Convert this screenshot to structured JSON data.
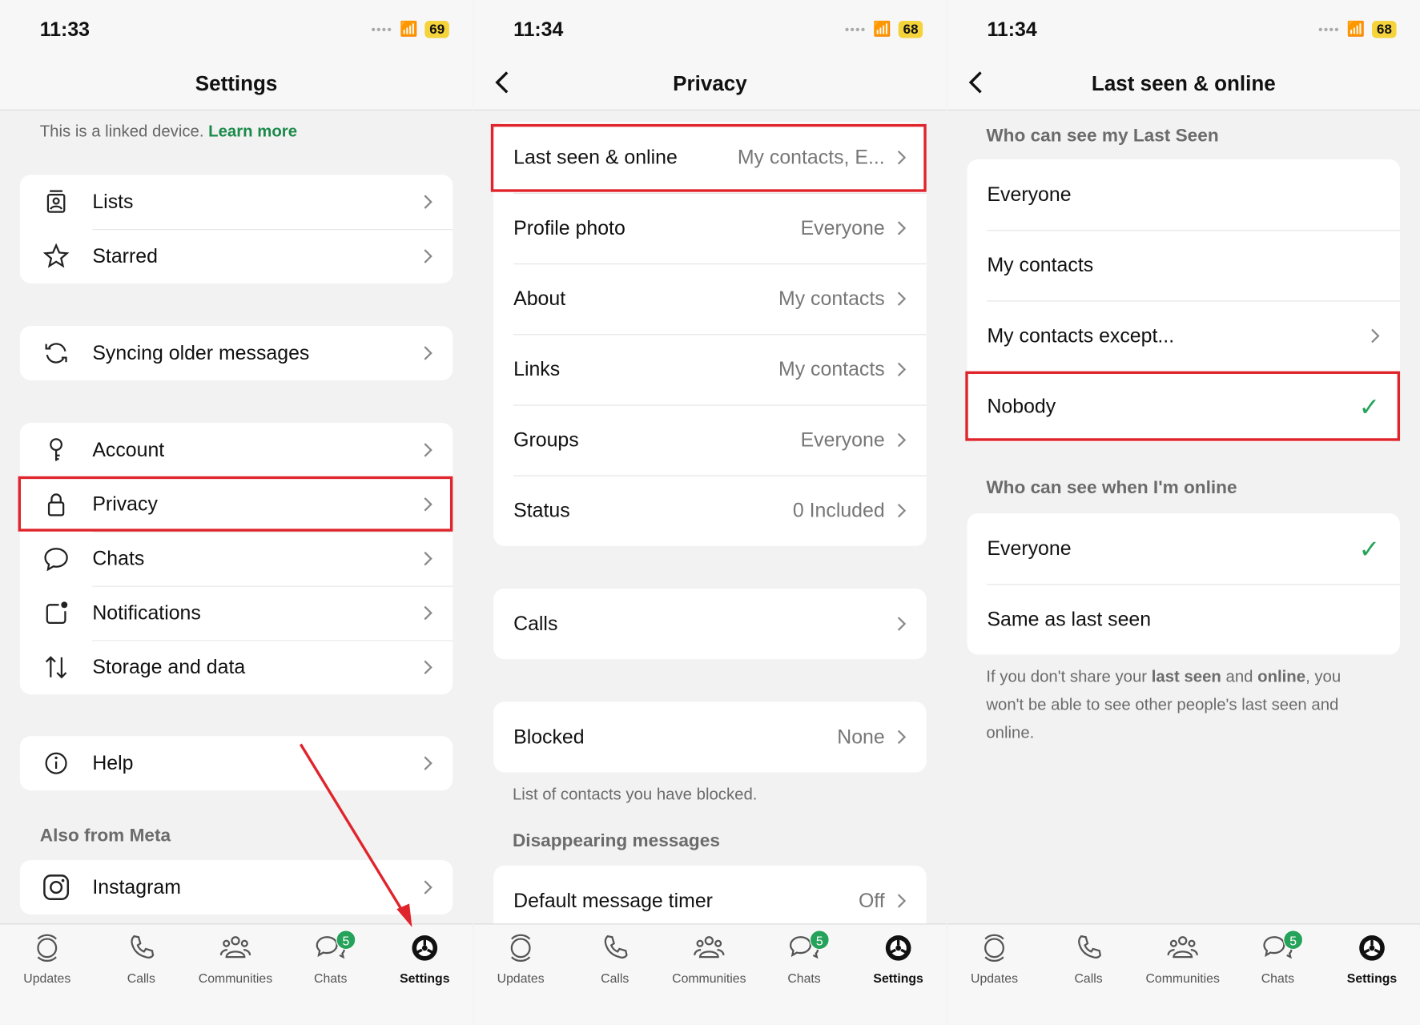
{
  "status": [
    {
      "time": "11:33",
      "battery": "69"
    },
    {
      "time": "11:34",
      "battery": "68"
    },
    {
      "time": "11:34",
      "battery": "68"
    }
  ],
  "settings": {
    "title": "Settings",
    "linked_text": "This is a linked device.",
    "learn_more": "Learn more",
    "groups": [
      [
        {
          "label": "Lists",
          "icon": "lists-icon"
        },
        {
          "label": "Starred",
          "icon": "star-icon"
        }
      ],
      [
        {
          "label": "Syncing older messages",
          "icon": "sync-icon"
        }
      ],
      [
        {
          "label": "Account",
          "icon": "key-icon"
        },
        {
          "label": "Privacy",
          "icon": "lock-icon"
        },
        {
          "label": "Chats",
          "icon": "chat-icon"
        },
        {
          "label": "Notifications",
          "icon": "notification-icon"
        },
        {
          "label": "Storage and data",
          "icon": "storage-icon"
        }
      ],
      [
        {
          "label": "Help",
          "icon": "info-icon"
        }
      ]
    ],
    "also_from_meta": "Also from Meta",
    "instagram": "Instagram"
  },
  "privacy": {
    "title": "Privacy",
    "rows": [
      {
        "label": "Last seen & online",
        "value": "My contacts, E..."
      },
      {
        "label": "Profile photo",
        "value": "Everyone"
      },
      {
        "label": "About",
        "value": "My contacts"
      },
      {
        "label": "Links",
        "value": "My contacts"
      },
      {
        "label": "Groups",
        "value": "Everyone"
      },
      {
        "label": "Status",
        "value": "0 Included"
      }
    ],
    "calls": "Calls",
    "blocked": {
      "label": "Blocked",
      "value": "None"
    },
    "blocked_note": "List of contacts you have blocked.",
    "disappearing_header": "Disappearing messages",
    "timer": {
      "label": "Default message timer",
      "value": "Off"
    }
  },
  "last_seen": {
    "title": "Last seen & online",
    "section1": "Who can see my Last Seen",
    "options1": [
      "Everyone",
      "My contacts",
      "My contacts except...",
      "Nobody"
    ],
    "section2": "Who can see when I'm online",
    "options2": [
      "Everyone",
      "Same as last seen"
    ],
    "note_parts": [
      "If you don't share your ",
      "last seen",
      " and ",
      "online",
      ", you won't be able to see other people's last seen and online."
    ]
  },
  "tabs": [
    {
      "label": "Updates"
    },
    {
      "label": "Calls"
    },
    {
      "label": "Communities"
    },
    {
      "label": "Chats",
      "badge": "5"
    },
    {
      "label": "Settings"
    }
  ],
  "colors": {
    "accent": "#25a35a",
    "highlight": "#e0242c"
  }
}
